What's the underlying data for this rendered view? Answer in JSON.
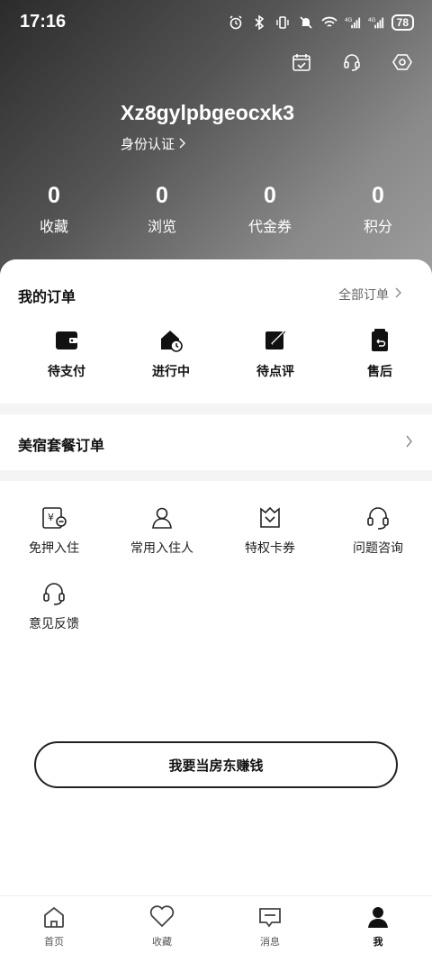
{
  "status_bar": {
    "time": "17:16",
    "battery": "78",
    "network": "4G"
  },
  "profile": {
    "username": "Xz8gylpbgeocxk3",
    "verify_label": "身份认证"
  },
  "stats": [
    {
      "value": "0",
      "label": "收藏"
    },
    {
      "value": "0",
      "label": "浏览"
    },
    {
      "value": "0",
      "label": "代金券"
    },
    {
      "value": "0",
      "label": "积分"
    }
  ],
  "orders": {
    "title": "我的订单",
    "all_label": "全部订单",
    "items": [
      {
        "label": "待支付",
        "icon": "wallet-icon"
      },
      {
        "label": "进行中",
        "icon": "house-clock-icon"
      },
      {
        "label": "待点评",
        "icon": "review-icon"
      },
      {
        "label": "售后",
        "icon": "after-sales-icon"
      }
    ]
  },
  "bnb_orders": {
    "title": "美宿套餐订单"
  },
  "services": [
    {
      "label": "免押入住",
      "icon": "deposit-free-icon"
    },
    {
      "label": "常用入住人",
      "icon": "guest-icon"
    },
    {
      "label": "特权卡券",
      "icon": "crown-coupon-icon"
    },
    {
      "label": "问题咨询",
      "icon": "headset-icon"
    },
    {
      "label": "意见反馈",
      "icon": "feedback-headset-icon"
    }
  ],
  "host_button": {
    "label": "我要当房东赚钱"
  },
  "tabbar": [
    {
      "label": "首页",
      "icon": "home-icon"
    },
    {
      "label": "收藏",
      "icon": "heart-icon"
    },
    {
      "label": "消息",
      "icon": "message-icon"
    },
    {
      "label": "我",
      "icon": "person-icon",
      "active": true
    }
  ]
}
